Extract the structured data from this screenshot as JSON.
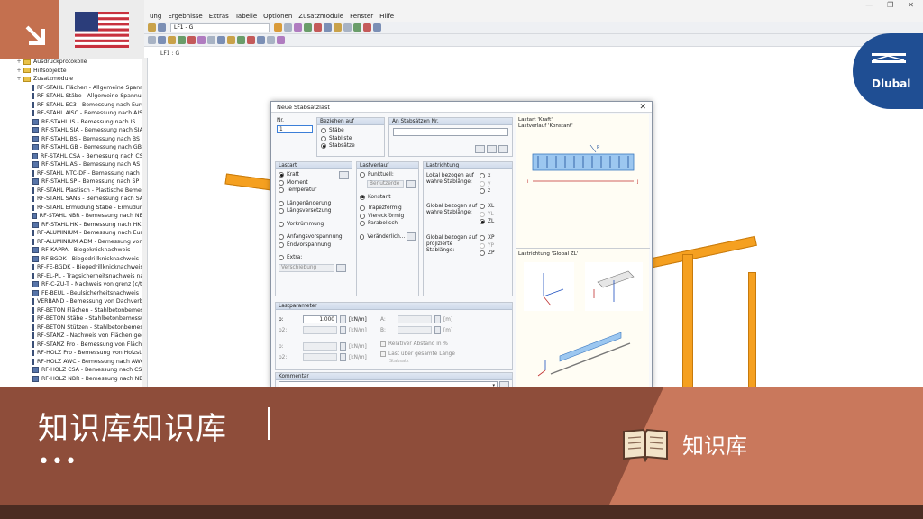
{
  "app": {
    "menu": [
      "ung",
      "Ergebnisse",
      "Extras",
      "Tabelle",
      "Optionen",
      "Zusatzmodule",
      "Fenster",
      "Hilfe"
    ],
    "loadcase_combo": "LF1 - G",
    "viewport_label": "LF1 : G"
  },
  "tree": {
    "items": [
      {
        "label": "Ausdruckprotokolle",
        "type": "folder"
      },
      {
        "label": "Hilfsobjekte",
        "type": "folder"
      },
      {
        "label": "Zusatzmodule",
        "type": "folder"
      },
      {
        "label": "RF-STAHL Flächen - Allgemeine Spannun",
        "type": "module"
      },
      {
        "label": "RF-STAHL Stäbe - Allgemeine Spannungs",
        "type": "module"
      },
      {
        "label": "RF-STAHL EC3 - Bemessung nach Eurocc",
        "type": "module"
      },
      {
        "label": "RF-STAHL AISC - Bemessung nach AISC (",
        "type": "module"
      },
      {
        "label": "RF-STAHL IS - Bemessung nach IS",
        "type": "module"
      },
      {
        "label": "RF-STAHL SIA - Bemessung nach SIA",
        "type": "module"
      },
      {
        "label": "RF-STAHL BS - Bemessung nach BS",
        "type": "module"
      },
      {
        "label": "RF-STAHL GB - Bemessung nach GB",
        "type": "module"
      },
      {
        "label": "RF-STAHL CSA - Bemessung nach CSA",
        "type": "module"
      },
      {
        "label": "RF-STAHL AS - Bemessung nach AS",
        "type": "module"
      },
      {
        "label": "RF-STAHL NTC-DF - Bemessung nach NT",
        "type": "module"
      },
      {
        "label": "RF-STAHL SP - Bemessung nach SP",
        "type": "module"
      },
      {
        "label": "RF-STAHL Plastisch - Plastische Bemessur",
        "type": "module"
      },
      {
        "label": "RF-STAHL SANS - Bemessung nach SANS",
        "type": "module"
      },
      {
        "label": "RF-STAHL Ermüdung Stäbe - Ermüdungs",
        "type": "module"
      },
      {
        "label": "RF-STAHL NBR - Bemessung nach NBR",
        "type": "module"
      },
      {
        "label": "RF-STAHL HK - Bemessung nach HK",
        "type": "module"
      },
      {
        "label": "RF-ALUMINIUM - Bemessung nach Eurod",
        "type": "module"
      },
      {
        "label": "RF-ALUMINIUM ADM - Bemessung von S",
        "type": "module"
      },
      {
        "label": "RF-KAPPA - Biegeknicknachweis",
        "type": "module"
      },
      {
        "label": "RF-BGDK - Biegedrillknicknachweis",
        "type": "module"
      },
      {
        "label": "RF-FE-BGDK - Biegedrillknicknachweis m",
        "type": "module"
      },
      {
        "label": "RF-EL-PL - Tragsicherheitsnachweis nach",
        "type": "module"
      },
      {
        "label": "RF-C-ZU-T - Nachweis von grenz (c/t)",
        "type": "module"
      },
      {
        "label": "FE-BEUL - Beulsicherheitsnachweis",
        "type": "module"
      },
      {
        "label": "VERBAND - Bemessung von Dachverbänd",
        "type": "module"
      },
      {
        "label": "RF-BETON Flächen - Stahlbetonbemessur",
        "type": "module"
      },
      {
        "label": "RF-BETON Stäbe - Stahlbetonbemessung",
        "type": "module"
      },
      {
        "label": "RF-BETON Stützen - Stahlbetonbemessur",
        "type": "module"
      },
      {
        "label": "RF-STANZ - Nachweis von Flächen geger",
        "type": "module"
      },
      {
        "label": "RF-STANZ Pro - Bemessung von Flächen ge",
        "type": "module"
      },
      {
        "label": "RF-HOLZ Pro - Bemessung von Holzstäbe",
        "type": "module"
      },
      {
        "label": "RF-HOLZ AWC - Bemessung nach AWC (",
        "type": "module"
      },
      {
        "label": "RF-HOLZ CSA - Bemessung nach CSA",
        "type": "module"
      },
      {
        "label": "RF-HOLZ NBR - Bemessung nach NBR",
        "type": "module"
      }
    ]
  },
  "dialog": {
    "title": "Neue Stabsatzlast",
    "nr_label": "Nr.",
    "nr_value": "1",
    "beziehen_label": "Beziehen auf",
    "beziehen_options": [
      {
        "label": "Stäbe",
        "selected": false
      },
      {
        "label": "Stabliste",
        "selected": false
      },
      {
        "label": "Stabsätze",
        "selected": true
      }
    ],
    "an_label": "An Stabsätzen Nr.",
    "lastart_label": "Lastart",
    "lastart_options": [
      {
        "label": "Kraft",
        "selected": true
      },
      {
        "label": "Moment",
        "selected": false
      },
      {
        "label": "Temperatur",
        "selected": false
      },
      {
        "label": "Längenänderung",
        "selected": false
      },
      {
        "label": "Längsversetzung",
        "selected": false
      },
      {
        "label": "Vorkrümmung",
        "selected": false
      },
      {
        "label": "Anfangsvorspannung",
        "selected": false
      },
      {
        "label": "Endvorspannung",
        "selected": false
      },
      {
        "label": "Extra:",
        "selected": false
      }
    ],
    "extra_value": "Verschiebung",
    "lastverlauf_label": "Lastverlauf",
    "lastverlauf_options": [
      {
        "label": "Punktuell:",
        "selected": false
      },
      {
        "label": "Konstant",
        "selected": true
      },
      {
        "label": "Trapezförmig",
        "selected": false
      },
      {
        "label": "Viereckförmig",
        "selected": false
      },
      {
        "label": "Parabolisch",
        "selected": false
      },
      {
        "label": "Veränderlich...",
        "selected": false
      }
    ],
    "punktuell_value": "Benutzerde",
    "lastrichtung_label": "Lastrichtung",
    "lokal_label": "Lokal bezogen auf wahre Stablänge:",
    "lokal_options": [
      {
        "label": "x",
        "selected": false,
        "enabled": true
      },
      {
        "label": "y",
        "selected": false,
        "enabled": false
      },
      {
        "label": "z",
        "selected": false,
        "enabled": true
      }
    ],
    "global_label": "Global bezogen auf wahre Stablänge:",
    "global_options": [
      {
        "label": "XL",
        "selected": false,
        "enabled": true
      },
      {
        "label": "YL",
        "selected": false,
        "enabled": false
      },
      {
        "label": "ZL",
        "selected": true,
        "enabled": true
      }
    ],
    "proj_label": "Global bezogen auf projizierte Stablänge:",
    "proj_options": [
      {
        "label": "XP",
        "selected": false,
        "enabled": true
      },
      {
        "label": "YP",
        "selected": false,
        "enabled": false
      },
      {
        "label": "ZP",
        "selected": false,
        "enabled": true
      }
    ],
    "lastparameter_label": "Lastparameter",
    "p_label": "p:",
    "p_value": "1.000",
    "p_unit": "[kN/m]",
    "p2_label": "p2:",
    "p2_unit": "[kN/m]",
    "p3_label": "p:",
    "p3_unit": "[kN/m]",
    "p4_label": "p2:",
    "p4_unit": "[kN/m]",
    "a_label": "A:",
    "a_unit": "[m]",
    "b_label": "B:",
    "b_unit": "[m]",
    "rel_label": "Relativer Abstand in %",
    "ueber_label": "Last über gesamte Länge",
    "stabsatz_label": "Stabsatz",
    "kommentar_label": "Kommentar",
    "preview_title1": "Lastart 'Kraft'",
    "preview_title2": "Lastverlauf 'Konstant'",
    "preview_p": "P",
    "preview_i": "i",
    "preview_j": "j",
    "preview_dir_title": "Lastrichtung 'Global ZL'"
  },
  "banner": {
    "title": "知识库知识库",
    "dots": "•••",
    "category": "知识库"
  },
  "logo": {
    "text": "Dlubal"
  },
  "colors": {
    "banner": "#8e4d3a",
    "banner_accent": "#c9785c",
    "beam": "#f5a020",
    "logo_blue": "#1f4e93"
  }
}
